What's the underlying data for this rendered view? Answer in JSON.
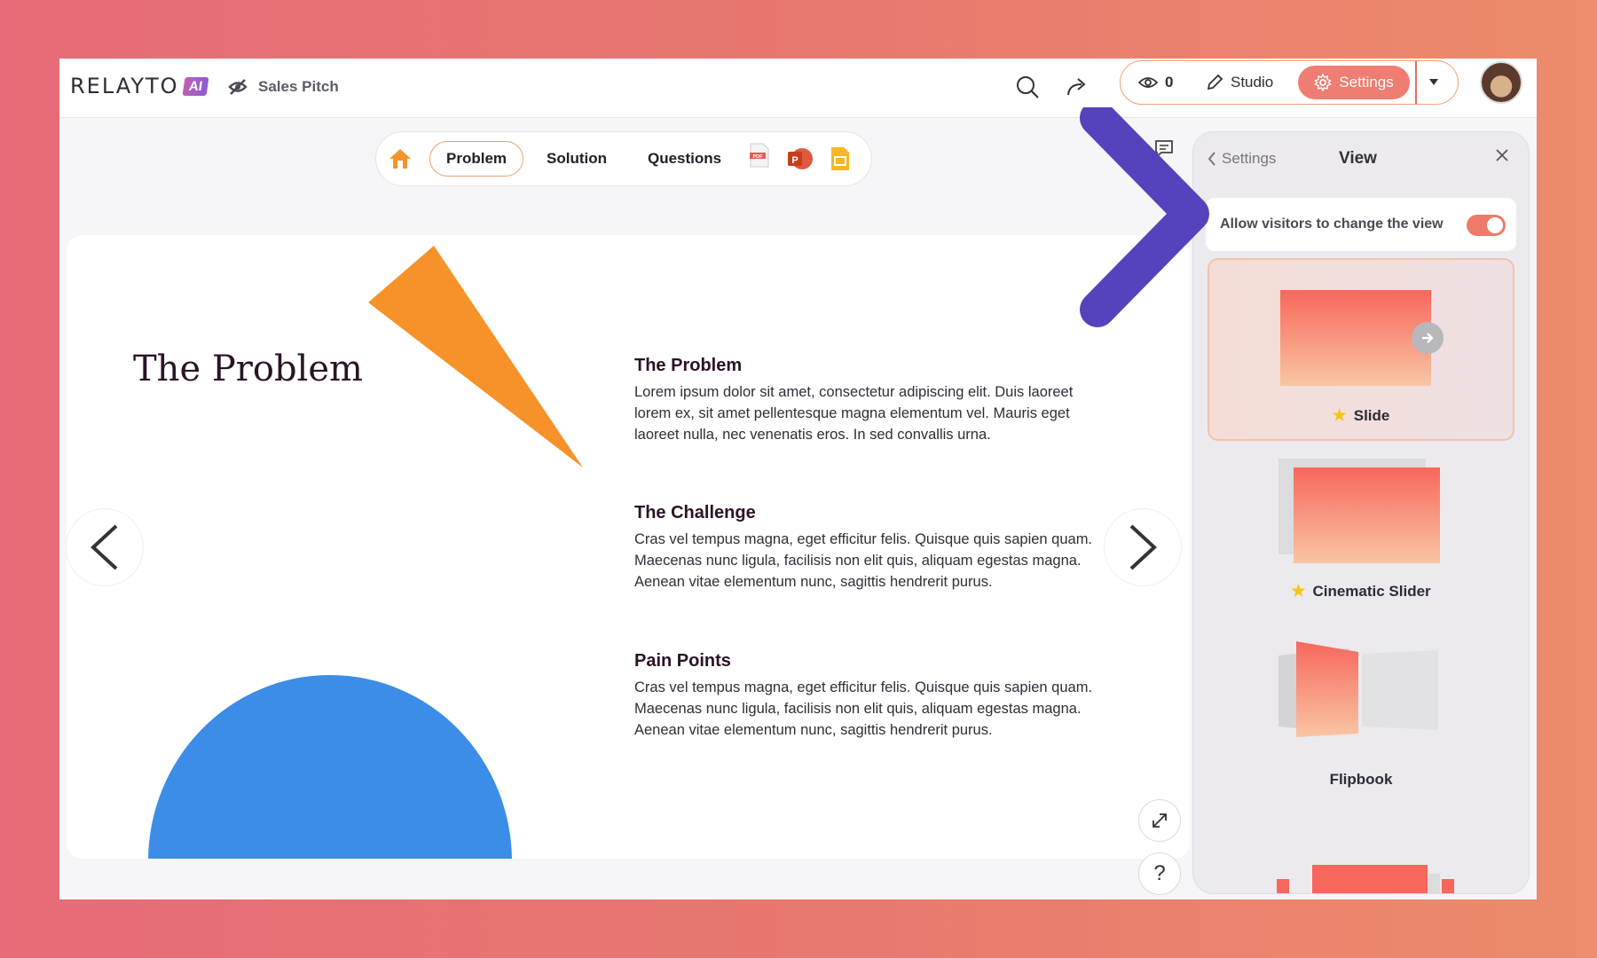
{
  "header": {
    "logo_text": "RELAYTO",
    "logo_badge": "AI",
    "project_title": "Sales Pitch",
    "view_count": "0",
    "studio_label": "Studio",
    "settings_label": "Settings"
  },
  "nav": {
    "items": [
      {
        "label": "Problem"
      },
      {
        "label": "Solution"
      },
      {
        "label": "Questions"
      }
    ],
    "pdf_label": "PDF"
  },
  "slide": {
    "title": "The Problem",
    "sections": [
      {
        "heading": "The Problem",
        "body": "Lorem ipsum dolor sit amet, consectetur adipiscing elit. Duis laoreet lorem ex, sit amet pellentesque magna elementum vel. Mauris eget laoreet nulla, nec venenatis eros. In sed convallis urna."
      },
      {
        "heading": "The Challenge",
        "body": "Cras vel tempus magna, eget efficitur felis. Quisque quis sapien quam. Maecenas nunc ligula, facilisis non elit quis, aliquam egestas magna. Aenean vitae elementum nunc, sagittis hendrerit purus."
      },
      {
        "heading": "Pain Points",
        "body": "Cras vel tempus magna, eget efficitur felis. Quisque quis sapien quam. Maecenas nunc ligula, facilisis non elit quis, aliquam egestas magna. Aenean vitae elementum nunc, sagittis hendrerit purus."
      }
    ]
  },
  "help_label": "?",
  "panel": {
    "back_label": "Settings",
    "title": "View",
    "toggle_label": "Allow visitors to change the view",
    "toggle_on": true,
    "views": [
      {
        "label": "Slide",
        "starred": true,
        "selected": true
      },
      {
        "label": "Cinematic Slider",
        "starred": true,
        "selected": false
      },
      {
        "label": "Flipbook",
        "starred": false,
        "selected": false
      }
    ]
  },
  "colors": {
    "accent": "#ef7d72",
    "orange": "#f7922a",
    "blue": "#3b8de8",
    "arrow_start": "#f47e96",
    "arrow_end": "#5543bd"
  }
}
